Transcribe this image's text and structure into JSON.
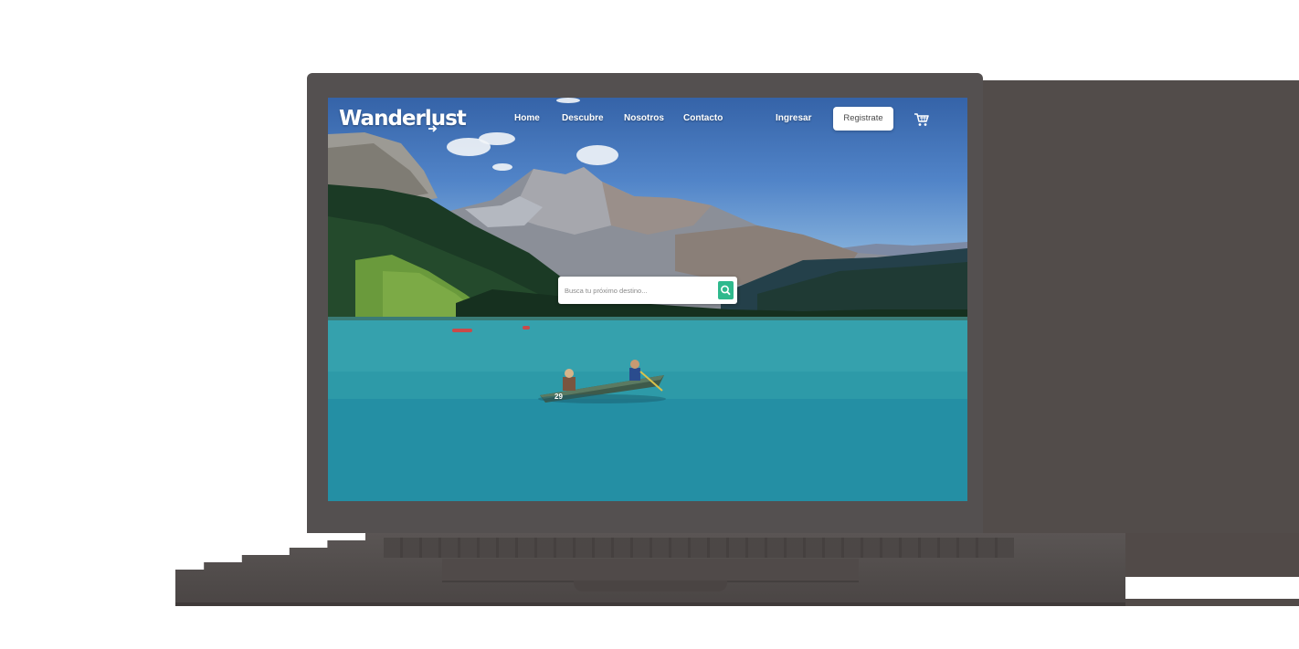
{
  "app": {
    "logo_text": "Wanderlust"
  },
  "nav": {
    "items": [
      {
        "label": "Home"
      },
      {
        "label": "Descubre"
      },
      {
        "label": "Nosotros"
      },
      {
        "label": "Contacto"
      }
    ],
    "login_label": "Ingresar",
    "register_label": "Registrate"
  },
  "search": {
    "placeholder": "Busca tu próximo destino..."
  },
  "icons": {
    "cart": "shopping-cart-icon",
    "search": "search-icon",
    "logo_arrow": "arrow-icon"
  },
  "hero": {
    "canoe_number": "29"
  },
  "colors": {
    "accent": "#2fb98d",
    "laptop": "#545050",
    "lake": "#2d9aa8"
  }
}
